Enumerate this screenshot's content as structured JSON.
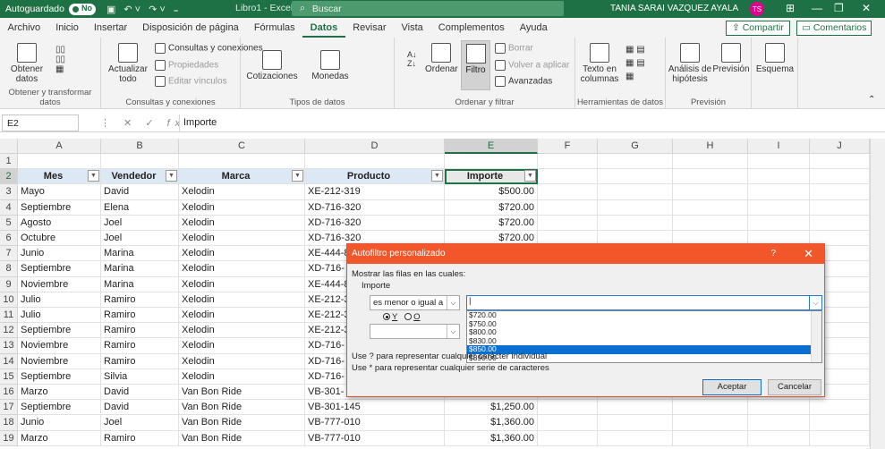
{
  "titlebar": {
    "autosave": "Autoguardado",
    "autosave_state": "No",
    "doc_title": "Libro1 - Excel",
    "search_placeholder": "Buscar",
    "user": "TANIA SARAI VAZQUEZ AYALA",
    "initials": "TS"
  },
  "menu": {
    "tabs": [
      "Archivo",
      "Inicio",
      "Insertar",
      "Disposición de página",
      "Fórmulas",
      "Datos",
      "Revisar",
      "Vista",
      "Complementos",
      "Ayuda"
    ],
    "share": "Compartir",
    "comments": "Comentarios"
  },
  "ribbon": {
    "g1": {
      "btn": "Obtener datos",
      "label": "Obtener y transformar datos"
    },
    "g2": {
      "btn": "Actualizar todo",
      "l1": "Consultas y conexiones",
      "l2": "Propiedades",
      "l3": "Editar vínculos",
      "label": "Consultas y conexiones"
    },
    "g3": {
      "b1": "Cotizaciones",
      "b2": "Monedas",
      "label": "Tipos de datos"
    },
    "g4": {
      "ordenar": "Ordenar",
      "filtro": "Filtro",
      "borrar": "Borrar",
      "volver": "Volver a aplicar",
      "avanzadas": "Avanzadas",
      "label": "Ordenar y filtrar"
    },
    "g5": {
      "btn": "Texto en columnas",
      "label": "Herramientas de datos"
    },
    "g6": {
      "b1": "Análisis de hipótesis",
      "b2": "Previsión",
      "label": "Previsión"
    },
    "g7": {
      "btn": "Esquema"
    }
  },
  "formula": {
    "namebox": "E2",
    "fx": "fx",
    "value": "Importe"
  },
  "sheet": {
    "columns": [
      "A",
      "B",
      "C",
      "D",
      "E",
      "F",
      "G",
      "H",
      "I",
      "J"
    ],
    "headers": [
      "Mes",
      "Vendedor",
      "Marca",
      "Producto",
      "Importe"
    ],
    "rows": [
      [
        "Mayo",
        "David",
        "Xelodin",
        "XE-212-319",
        "$500.00"
      ],
      [
        "Septiembre",
        "Elena",
        "Xelodin",
        "XD-716-320",
        "$720.00"
      ],
      [
        "Agosto",
        "Joel",
        "Xelodin",
        "XD-716-320",
        "$720.00"
      ],
      [
        "Octubre",
        "Joel",
        "Xelodin",
        "XD-716-320",
        "$720.00"
      ],
      [
        "Junio",
        "Marina",
        "Xelodin",
        "XE-444-8",
        ""
      ],
      [
        "Septiembre",
        "Marina",
        "Xelodin",
        "XD-716-",
        ""
      ],
      [
        "Noviembre",
        "Marina",
        "Xelodin",
        "XE-444-8",
        ""
      ],
      [
        "Julio",
        "Ramiro",
        "Xelodin",
        "XE-212-3",
        ""
      ],
      [
        "Julio",
        "Ramiro",
        "Xelodin",
        "XE-212-3",
        ""
      ],
      [
        "Septiembre",
        "Ramiro",
        "Xelodin",
        "XE-212-3",
        ""
      ],
      [
        "Noviembre",
        "Ramiro",
        "Xelodin",
        "XD-716-",
        ""
      ],
      [
        "Noviembre",
        "Ramiro",
        "Xelodin",
        "XD-716-",
        ""
      ],
      [
        "Septiembre",
        "Silvia",
        "Xelodin",
        "XD-716-",
        ""
      ],
      [
        "Marzo",
        "David",
        "Van Bon Ride",
        "VB-301-",
        ""
      ],
      [
        "Septiembre",
        "David",
        "Van Bon Ride",
        "VB-301-145",
        "$1,250.00"
      ],
      [
        "Junio",
        "Joel",
        "Van Bon Ride",
        "VB-777-010",
        "$1,360.00"
      ],
      [
        "Marzo",
        "Ramiro",
        "Van Bon Ride",
        "VB-777-010",
        "$1,360.00"
      ]
    ]
  },
  "dialog": {
    "title": "Autofiltro personalizado",
    "help": "?",
    "close": "✕",
    "show_rows": "Mostrar las filas en las cuales:",
    "field": "Importe",
    "operator": "es menor o igual a",
    "and_label": "Y",
    "or_label": "O",
    "options": [
      "$720.00",
      "$750.00",
      "$800.00",
      "$830.00",
      "$850.00",
      "$890.00"
    ],
    "highlighted": "$850.00",
    "hint1": "Use ? para representar cualquier carácter individual",
    "hint2": "Use * para representar cualquier serie de caracteres",
    "ok": "Aceptar",
    "cancel": "Cancelar"
  },
  "colors": {
    "excel_green": "#1e7145",
    "dialog_title": "#f2572b",
    "table_header": "#dde8f5",
    "highlight": "#0a6fd1"
  }
}
